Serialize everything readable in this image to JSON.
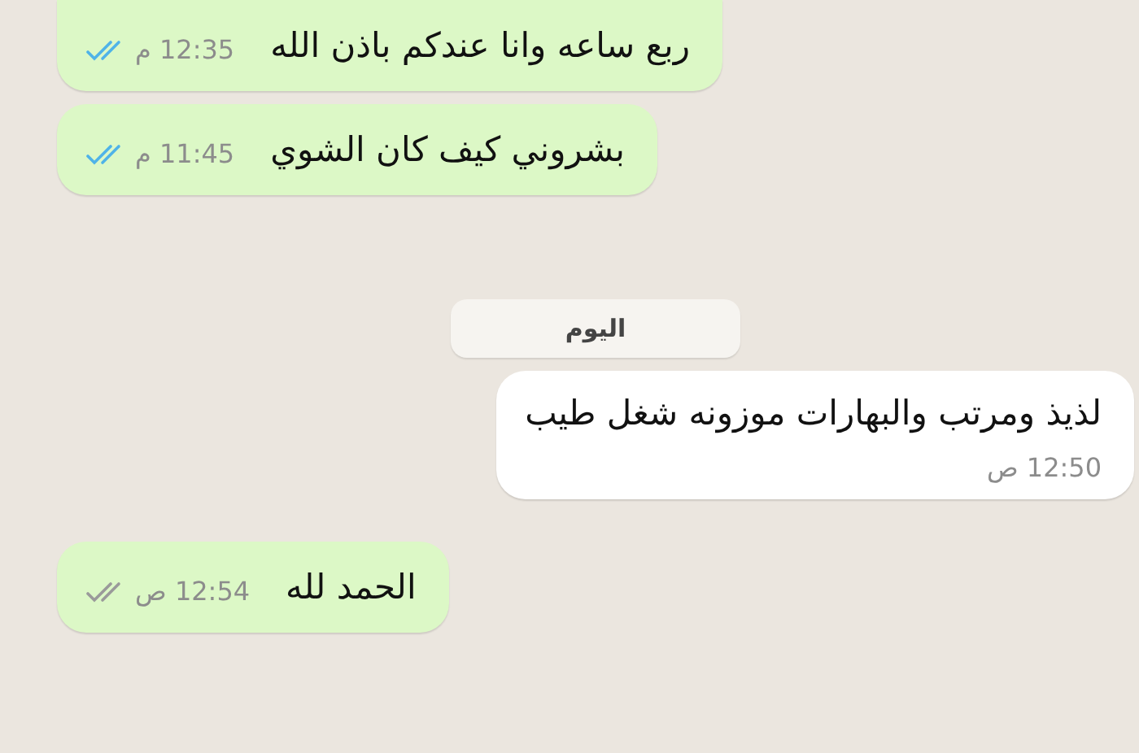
{
  "messages": [
    {
      "kind": "outgoing",
      "text": "ربع ساعه وانا عندكم باذن الله",
      "time": "12:35 م",
      "read": true
    },
    {
      "kind": "outgoing",
      "text": "بشروني كيف كان الشوي",
      "time": "11:45 م",
      "read": true
    },
    {
      "kind": "date",
      "text": "اليوم"
    },
    {
      "kind": "incoming",
      "text": "لذيذ ومرتب والبهارات موزونه شغل طيب",
      "time": "12:50 ص"
    },
    {
      "kind": "outgoing",
      "text": "الحمد لله",
      "time": "12:54 ص",
      "read": false
    }
  ]
}
